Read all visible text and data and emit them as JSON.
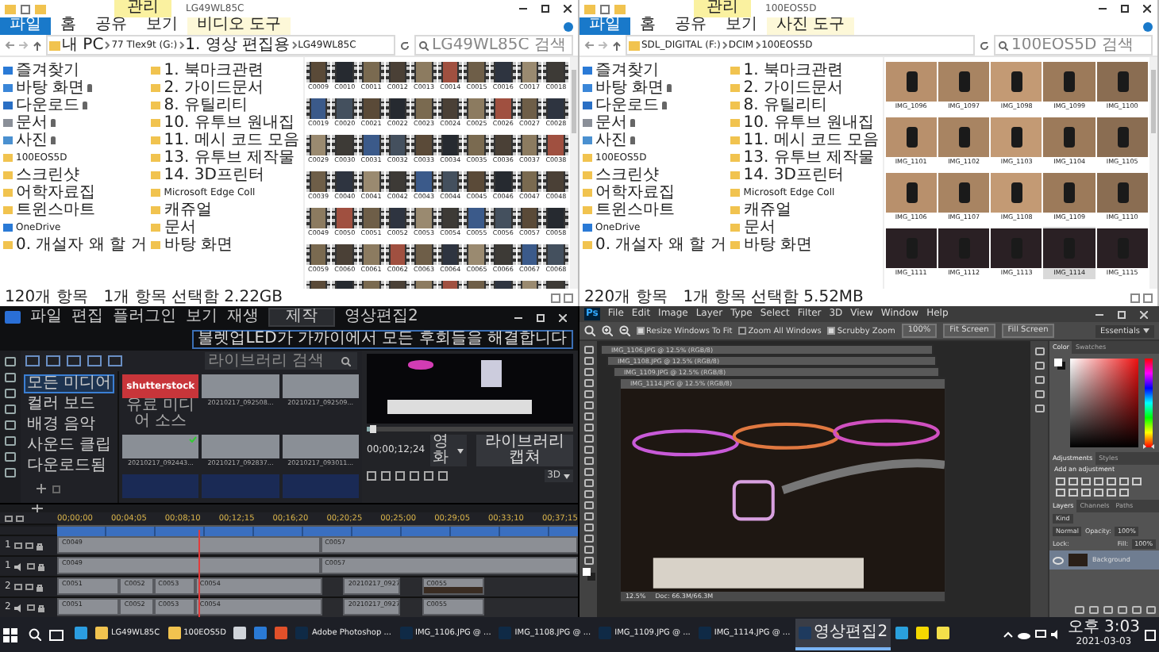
{
  "explorers": [
    {
      "title": "LG49WL85C",
      "context_tab": {
        "label": "관리",
        "group": "비디오 도구"
      },
      "ribbon_tabs": [
        {
          "label": "파일",
          "kind": "file"
        },
        {
          "label": "홈",
          "kind": "tab"
        },
        {
          "label": "공유",
          "kind": "tab"
        },
        {
          "label": "보기",
          "kind": "tab"
        }
      ],
      "address": [
        "내 PC",
        "77 Tlex9t (G:)",
        "1. 영상 편집용",
        "LG49WL85C"
      ],
      "search": {
        "placeholder": "LG49WL85C 검색"
      },
      "sidebar": [
        {
          "label": "즐겨찾기",
          "kind": "star",
          "pinned": false
        },
        {
          "label": "바탕 화면",
          "kind": "desktop",
          "pinned": true
        },
        {
          "label": "다운로드",
          "kind": "download",
          "pinned": true
        },
        {
          "label": "문서",
          "kind": "document",
          "pinned": true
        },
        {
          "label": "사진",
          "kind": "picture",
          "pinned": true
        },
        {
          "label": "100EOS5D",
          "kind": "folder",
          "pinned": false
        },
        {
          "label": "스크린샷",
          "kind": "folder",
          "pinned": false
        },
        {
          "label": "어학자료집",
          "kind": "folder",
          "pinned": false
        },
        {
          "label": "트윈스마트",
          "kind": "folder",
          "pinned": false
        },
        {
          "label": "OneDrive",
          "kind": "cloud",
          "pinned": false
        },
        {
          "label": "0. 개설자 왜 할 거",
          "kind": "folder",
          "pinned": false
        },
        {
          "label": "1. 북마크관련",
          "kind": "folder",
          "pinned": false
        },
        {
          "label": "2. 가이드문서",
          "kind": "folder",
          "pinned": false
        },
        {
          "label": "8. 유틸리티",
          "kind": "folder",
          "pinned": false
        },
        {
          "label": "10. 유투브 원내집",
          "kind": "folder",
          "pinned": false
        },
        {
          "label": "11. 메시 코드 모음",
          "kind": "folder",
          "pinned": false
        },
        {
          "label": "13. 유투브 제작물",
          "kind": "folder",
          "pinned": false
        },
        {
          "label": "14. 3D프린터",
          "kind": "folder",
          "pinned": false
        },
        {
          "label": "Microsoft Edge Coll",
          "kind": "folder",
          "pinned": false
        },
        {
          "label": "캐쥬얼",
          "kind": "folder",
          "pinned": false
        },
        {
          "label": "문서",
          "kind": "folder",
          "pinned": false
        },
        {
          "label": "바탕 화면",
          "kind": "folder",
          "pinned": false
        }
      ],
      "files": [
        {
          "name": "C0009",
          "kind": "video",
          "selected": false
        },
        {
          "name": "C0010",
          "kind": "video",
          "selected": false
        },
        {
          "name": "C0011",
          "kind": "video",
          "selected": false
        },
        {
          "name": "C0012",
          "kind": "video",
          "selected": false
        },
        {
          "name": "C0013",
          "kind": "video",
          "selected": false
        },
        {
          "name": "C0014",
          "kind": "video",
          "selected": false
        },
        {
          "name": "C0015",
          "kind": "video",
          "selected": false
        },
        {
          "name": "C0016",
          "kind": "video",
          "selected": false
        },
        {
          "name": "C0017",
          "kind": "video",
          "selected": false
        },
        {
          "name": "C0018",
          "kind": "video",
          "selected": false
        },
        {
          "name": "C0019",
          "kind": "video",
          "selected": false
        },
        {
          "name": "C0020",
          "kind": "video",
          "selected": false
        },
        {
          "name": "C0021",
          "kind": "video",
          "selected": false
        },
        {
          "name": "C0022",
          "kind": "video",
          "selected": false
        },
        {
          "name": "C0023",
          "kind": "video",
          "selected": false
        },
        {
          "name": "C0024",
          "kind": "video",
          "selected": false
        },
        {
          "name": "C0025",
          "kind": "video",
          "selected": false
        },
        {
          "name": "C0026",
          "kind": "video",
          "selected": false
        },
        {
          "name": "C0027",
          "kind": "video",
          "selected": false
        },
        {
          "name": "C0028",
          "kind": "video",
          "selected": false
        },
        {
          "name": "C0029",
          "kind": "video",
          "selected": false
        },
        {
          "name": "C0030",
          "kind": "video",
          "selected": false
        },
        {
          "name": "C0031",
          "kind": "video",
          "selected": false
        },
        {
          "name": "C0032",
          "kind": "video",
          "selected": false
        },
        {
          "name": "C0033",
          "kind": "video",
          "selected": false
        },
        {
          "name": "C0034",
          "kind": "video",
          "selected": false
        },
        {
          "name": "C0035",
          "kind": "video",
          "selected": false
        },
        {
          "name": "C0036",
          "kind": "video",
          "selected": false
        },
        {
          "name": "C0037",
          "kind": "video",
          "selected": false
        },
        {
          "name": "C0038",
          "kind": "video",
          "selected": false
        },
        {
          "name": "C0039",
          "kind": "video",
          "selected": false
        },
        {
          "name": "C0040",
          "kind": "video",
          "selected": false
        },
        {
          "name": "C0041",
          "kind": "video",
          "selected": false
        },
        {
          "name": "C0042",
          "kind": "video",
          "selected": false
        },
        {
          "name": "C0043",
          "kind": "video",
          "selected": false
        },
        {
          "name": "C0044",
          "kind": "video",
          "selected": false
        },
        {
          "name": "C0045",
          "kind": "video",
          "selected": false
        },
        {
          "name": "C0046",
          "kind": "video",
          "selected": false
        },
        {
          "name": "C0047",
          "kind": "video",
          "selected": false
        },
        {
          "name": "C0048",
          "kind": "video",
          "selected": false
        },
        {
          "name": "C0049",
          "kind": "video",
          "selected": false
        },
        {
          "name": "C0050",
          "kind": "video",
          "selected": false
        },
        {
          "name": "C0051",
          "kind": "video",
          "selected": false
        },
        {
          "name": "C0052",
          "kind": "video",
          "selected": false
        },
        {
          "name": "C0053",
          "kind": "video",
          "selected": false
        },
        {
          "name": "C0054",
          "kind": "video",
          "selected": false
        },
        {
          "name": "C0055",
          "kind": "video",
          "selected": false
        },
        {
          "name": "C0056",
          "kind": "video",
          "selected": false
        },
        {
          "name": "C0057",
          "kind": "video",
          "selected": false
        },
        {
          "name": "C0058",
          "kind": "video",
          "selected": false
        },
        {
          "name": "C0059",
          "kind": "video",
          "selected": false
        },
        {
          "name": "C0060",
          "kind": "video",
          "selected": false
        },
        {
          "name": "C0061",
          "kind": "video",
          "selected": false
        },
        {
          "name": "C0062",
          "kind": "video",
          "selected": false
        },
        {
          "name": "C0063",
          "kind": "video",
          "selected": false
        },
        {
          "name": "C0064",
          "kind": "video",
          "selected": false
        },
        {
          "name": "C0065",
          "kind": "video",
          "selected": false
        },
        {
          "name": "C0066",
          "kind": "video",
          "selected": false
        },
        {
          "name": "C0067",
          "kind": "video",
          "selected": false
        },
        {
          "name": "C0068",
          "kind": "video",
          "selected": false
        },
        {
          "kind": "video",
          "selected": false
        },
        {
          "kind": "video",
          "selected": false
        },
        {
          "kind": "video",
          "selected": false
        },
        {
          "kind": "video",
          "selected": false
        },
        {
          "kind": "video",
          "selected": false
        },
        {
          "kind": "video",
          "selected": false
        },
        {
          "kind": "video",
          "selected": false
        },
        {
          "kind": "video",
          "selected": false
        },
        {
          "kind": "video",
          "selected": false
        },
        {
          "kind": "video",
          "selected": false
        }
      ],
      "status": [
        "120개 항목",
        "1개 항목 선택함 2.22GB"
      ]
    },
    {
      "title": "100EOS5D",
      "context_tab": {
        "label": "관리",
        "group": "사진 도구"
      },
      "ribbon_tabs": [
        {
          "label": "파일",
          "kind": "file"
        },
        {
          "label": "홈",
          "kind": "tab"
        },
        {
          "label": "공유",
          "kind": "tab"
        },
        {
          "label": "보기",
          "kind": "tab"
        }
      ],
      "address": [
        "SDL_DIGITAL (F:)",
        "DCIM",
        "100EOS5D"
      ],
      "search": {
        "placeholder": "100EOS5D 검색"
      },
      "sidebar": [
        {
          "label": "즐겨찾기",
          "kind": "star",
          "pinned": false
        },
        {
          "label": "바탕 화면",
          "kind": "desktop",
          "pinned": true
        },
        {
          "label": "다운로드",
          "kind": "download",
          "pinned": true
        },
        {
          "label": "문서",
          "kind": "document",
          "pinned": true
        },
        {
          "label": "사진",
          "kind": "picture",
          "pinned": true
        },
        {
          "label": "100EOS5D",
          "kind": "folder",
          "pinned": false
        },
        {
          "label": "스크린샷",
          "kind": "folder",
          "pinned": false
        },
        {
          "label": "어학자료집",
          "kind": "folder",
          "pinned": false
        },
        {
          "label": "트윈스마트",
          "kind": "folder",
          "pinned": false
        },
        {
          "label": "OneDrive",
          "kind": "cloud",
          "pinned": false
        },
        {
          "label": "0. 개설자 왜 할 거",
          "kind": "folder",
          "pinned": false
        },
        {
          "label": "1. 북마크관련",
          "kind": "folder",
          "pinned": false
        },
        {
          "label": "2. 가이드문서",
          "kind": "folder",
          "pinned": false
        },
        {
          "label": "8. 유틸리티",
          "kind": "folder",
          "pinned": false
        },
        {
          "label": "10. 유투브 원내집",
          "kind": "folder",
          "pinned": false
        },
        {
          "label": "11. 메시 코드 모음",
          "kind": "folder",
          "pinned": false
        },
        {
          "label": "13. 유투브 제작물",
          "kind": "folder",
          "pinned": false
        },
        {
          "label": "14. 3D프린터",
          "kind": "folder",
          "pinned": false
        },
        {
          "label": "Microsoft Edge Coll",
          "kind": "folder",
          "pinned": false
        },
        {
          "label": "캐쥬얼",
          "kind": "folder",
          "pinned": false
        },
        {
          "label": "문서",
          "kind": "folder",
          "pinned": false
        },
        {
          "label": "바탕 화면",
          "kind": "folder",
          "pinned": false
        }
      ],
      "files": [
        {
          "name": "IMG_1096",
          "kind": "photo",
          "selected": false
        },
        {
          "name": "IMG_1097",
          "kind": "photo",
          "selected": false
        },
        {
          "name": "IMG_1098",
          "kind": "photo",
          "selected": false
        },
        {
          "name": "IMG_1099",
          "kind": "photo",
          "selected": false
        },
        {
          "name": "IMG_1100",
          "kind": "photo",
          "selected": false
        },
        {
          "name": "IMG_1101",
          "kind": "photo",
          "selected": false
        },
        {
          "name": "IMG_1102",
          "kind": "photo",
          "selected": false
        },
        {
          "name": "IMG_1103",
          "kind": "photo",
          "selected": false
        },
        {
          "name": "IMG_1104",
          "kind": "photo",
          "selected": false
        },
        {
          "name": "IMG_1105",
          "kind": "photo",
          "selected": false
        },
        {
          "name": "IMG_1106",
          "kind": "photo",
          "selected": false
        },
        {
          "name": "IMG_1107",
          "kind": "photo",
          "selected": false
        },
        {
          "name": "IMG_1108",
          "kind": "photo",
          "selected": false
        },
        {
          "name": "IMG_1109",
          "kind": "photo",
          "selected": false
        },
        {
          "name": "IMG_1110",
          "kind": "photo",
          "selected": false
        },
        {
          "name": "IMG_1111",
          "kind": "photo",
          "selected": false
        },
        {
          "name": "IMG_1112",
          "kind": "photo",
          "selected": false
        },
        {
          "name": "IMG_1113",
          "kind": "photo",
          "selected": false
        },
        {
          "name": "IMG_1114",
          "kind": "photo",
          "selected": true
        },
        {
          "name": "IMG_1115",
          "kind": "photo",
          "selected": false
        }
      ],
      "status": [
        "220개 항목",
        "1개 항목 선택함 5.52MB"
      ]
    }
  ],
  "editor": {
    "menu": [
      "파일",
      "편집",
      "플러그인",
      "보기",
      "재생"
    ],
    "mode": "제작",
    "title": "영상편집2",
    "notice": "불렛업LED가 가까이에서 모든 후회들을 해결합니다",
    "search": {
      "placeholder": "라이브러리 검색"
    },
    "library_items": [
      {
        "label": "모든 미디어",
        "selected": true
      },
      {
        "label": "컬러 보드",
        "selected": false
      },
      {
        "label": "배경 음악",
        "selected": false
      },
      {
        "label": "사운드 클립",
        "selected": false
      },
      {
        "label": "다운로드됨",
        "selected": false
      }
    ],
    "media": [
      {
        "kind": "stock",
        "brand": "shutterstock",
        "label": "유료 미디어 소스",
        "in_use": false
      },
      {
        "kind": "video",
        "label": "20210217_092508...",
        "in_use": false
      },
      {
        "kind": "video",
        "label": "20210217_092509...",
        "in_use": false
      },
      {
        "kind": "video",
        "label": "20210217_092443...",
        "in_use": true
      },
      {
        "kind": "video",
        "label": "20210217_092837...",
        "in_use": false
      },
      {
        "kind": "video",
        "label": "20210217_093011...",
        "in_use": false
      },
      {
        "kind": "video",
        "in_use": false
      },
      {
        "kind": "video",
        "in_use": false
      },
      {
        "kind": "video",
        "in_use": false
      }
    ],
    "preview": {
      "seek": {
        "level": 0.03
      },
      "timecode": "00;00;12;24",
      "quality": "영화",
      "capture": "라이브러리 캡쳐",
      "mode": "3D"
    },
    "timeline": {
      "ruler": [
        "00;00;00",
        "00;04;05",
        "00;08;10",
        "00;12;15",
        "00;16;20",
        "00;20;25",
        "00;25;00",
        "00;29;05",
        "00;33;10",
        "00;37;15"
      ],
      "playhead": {
        "level": 0.27
      },
      "tracks": [
        {
          "number": "1",
          "kind": "video",
          "clips": [
            {
              "label": "C0049",
              "kind": "video"
            },
            {
              "label": "C0057",
              "kind": "video"
            }
          ]
        },
        {
          "number": "1",
          "kind": "audio",
          "clips": [
            {
              "label": "C0049",
              "kind": "audio"
            },
            {
              "label": "C0057",
              "kind": "audio"
            }
          ]
        },
        {
          "number": "2",
          "kind": "video",
          "clips": [
            {
              "label": "C0051",
              "kind": "video"
            },
            {
              "label": "C0052",
              "kind": "video"
            },
            {
              "label": "C0053",
              "kind": "video"
            },
            {
              "label": "C0054",
              "kind": "video"
            },
            {
              "label": "20210217_0927",
              "kind": "video"
            },
            {
              "label": "C0055",
              "kind": "photo"
            }
          ]
        },
        {
          "number": "2",
          "kind": "audio",
          "clips": [
            {
              "label": "C0051",
              "kind": "audio"
            },
            {
              "label": "C0052",
              "kind": "audio"
            },
            {
              "label": "C0053",
              "kind": "audio"
            },
            {
              "label": "C0054",
              "kind": "audio"
            },
            {
              "label": "20210217_0927",
              "kind": "audio"
            },
            {
              "label": "C0055",
              "kind": "audio"
            }
          ]
        }
      ]
    }
  },
  "photoshop": {
    "logo": "Ps",
    "hue_slider": {
      "level": 0
    },
    "menu": [
      "File",
      "Edit",
      "Image",
      "Layer",
      "Type",
      "Select",
      "Filter",
      "3D",
      "View",
      "Window",
      "Help"
    ],
    "options": [
      {
        "label": "Resize Windows To Fit",
        "kind": "check",
        "checked": true
      },
      {
        "label": "Zoom All Windows",
        "kind": "check",
        "checked": false
      },
      {
        "label": "Scrubby Zoom",
        "kind": "check",
        "checked": true
      },
      {
        "label": "100%",
        "kind": "button"
      },
      {
        "label": "Fit Screen",
        "kind": "button"
      },
      {
        "label": "Fill Screen",
        "kind": "button"
      }
    ],
    "workspace": "Essentials",
    "documents": [
      "IMG_1106.JPG @ 12.5% (RGB/8)",
      "IMG_1108.JPG @ 12.5% (RGB/8)",
      "IMG_1109.JPG @ 12.5% (RGB/8)",
      "IMG_1114.JPG @ 12.5% (RGB/8)"
    ],
    "zoom": "12.5%",
    "doc_info": "Doc: 66.3M/66.3M",
    "color_tabs": [
      {
        "label": "Color",
        "selected": true
      },
      {
        "label": "Swatches",
        "selected": false
      }
    ],
    "adjust_tabs": [
      {
        "label": "Adjustments",
        "selected": true
      },
      {
        "label": "Styles",
        "selected": false
      }
    ],
    "adjust_hint": "Add an adjustment",
    "layer_tabs": [
      {
        "label": "Layers",
        "selected": true
      },
      {
        "label": "Channels",
        "selected": false
      },
      {
        "label": "Paths",
        "selected": false
      }
    ],
    "filter": "Kind",
    "blend": "Normal",
    "opacity_label": "Opacity:",
    "opacity": "100%",
    "lock_label": "Lock:",
    "fill_label": "Fill:",
    "fill": "100%",
    "layers": [
      {
        "name": "Background",
        "selected": true,
        "visible": true
      }
    ]
  },
  "taskbar": {
    "items": [
      {
        "kind": "edge",
        "active": false
      },
      {
        "kind": "explorer",
        "label": "LG49WL85C",
        "active": false
      },
      {
        "kind": "explorer",
        "label": "100EOS5D",
        "active": false
      },
      {
        "kind": "store",
        "active": false
      },
      {
        "kind": "mail",
        "active": false
      },
      {
        "kind": "office",
        "active": false
      },
      {
        "kind": "photoshop",
        "label": "Adobe Photoshop ...",
        "active": false
      },
      {
        "kind": "photoshop",
        "label": "IMG_1106.JPG @ ...",
        "active": false
      },
      {
        "kind": "photoshop",
        "label": "IMG_1108.JPG @ ...",
        "active": false
      },
      {
        "kind": "photoshop",
        "label": "IMG_1109.JPG @ ...",
        "active": false
      },
      {
        "kind": "photoshop",
        "label": "IMG_1114.JPG @ ...",
        "active": false
      },
      {
        "kind": "director",
        "label": "영상편집2",
        "active": true
      },
      {
        "kind": "telegram",
        "active": false
      },
      {
        "kind": "kakao",
        "active": false
      },
      {
        "kind": "notes",
        "active": false
      }
    ],
    "time": "오후 3:03",
    "date": "2021-03-03"
  }
}
